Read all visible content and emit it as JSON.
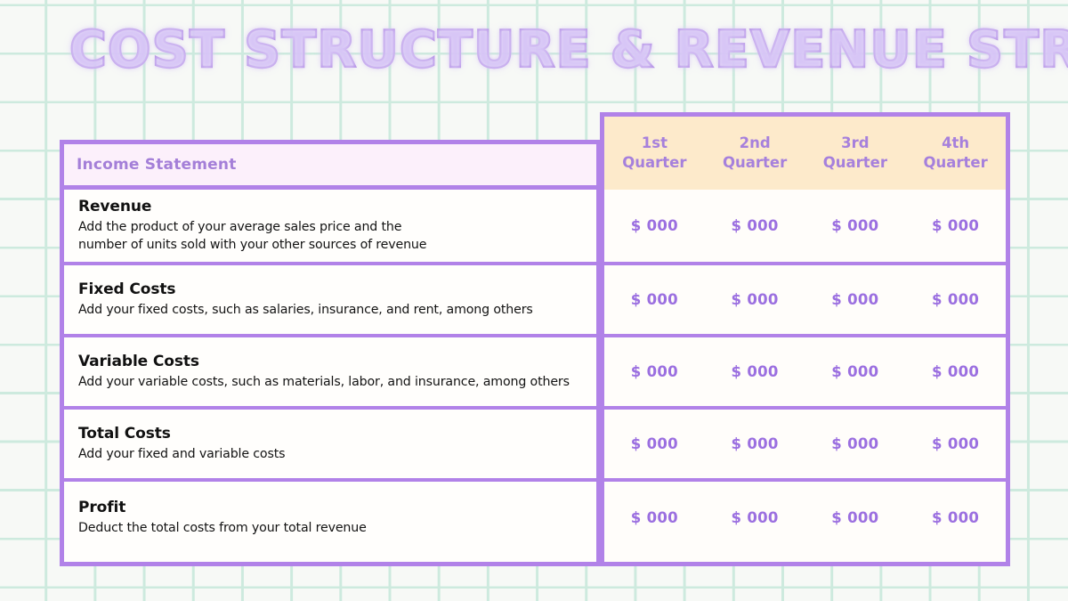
{
  "slide": {
    "title": "COST STRUCTURE & REVENUE STREAM",
    "background_color": "#f7f9f6",
    "grid_line_color": "#cdeade",
    "accent_purple": "#b182e8",
    "header_cream": "#fdeacb",
    "header_pink": "#fcf0fb"
  },
  "table": {
    "row_header_label": "Income Statement",
    "columns": [
      {
        "line1": "1st",
        "line2": "Quarter"
      },
      {
        "line1": "2nd",
        "line2": "Quarter"
      },
      {
        "line1": "3rd",
        "line2": "Quarter"
      },
      {
        "line1": "4th",
        "line2": "Quarter"
      }
    ],
    "rows": [
      {
        "name": "Revenue",
        "desc_line1": "Add the product of your average sales price and the",
        "desc_line2": "number of units sold with your other sources of revenue",
        "values": [
          "$ 000",
          "$ 000",
          "$ 000",
          "$ 000"
        ]
      },
      {
        "name": "Fixed Costs",
        "desc_line1": "Add your fixed costs, such as salaries, insurance, and rent, among others",
        "desc_line2": "",
        "values": [
          "$ 000",
          "$ 000",
          "$ 000",
          "$ 000"
        ]
      },
      {
        "name": "Variable Costs",
        "desc_line1": "Add your variable costs, such as materials, labor, and insurance, among others",
        "desc_line2": "",
        "values": [
          "$ 000",
          "$ 000",
          "$ 000",
          "$ 000"
        ]
      },
      {
        "name": "Total Costs",
        "desc_line1": "Add your fixed and variable costs",
        "desc_line2": "",
        "values": [
          "$ 000",
          "$ 000",
          "$ 000",
          "$ 000"
        ]
      },
      {
        "name": "Profit",
        "desc_line1": "Deduct the total costs from your total revenue",
        "desc_line2": "",
        "values": [
          "$ 000",
          "$ 000",
          "$ 000",
          "$ 000"
        ]
      }
    ]
  }
}
